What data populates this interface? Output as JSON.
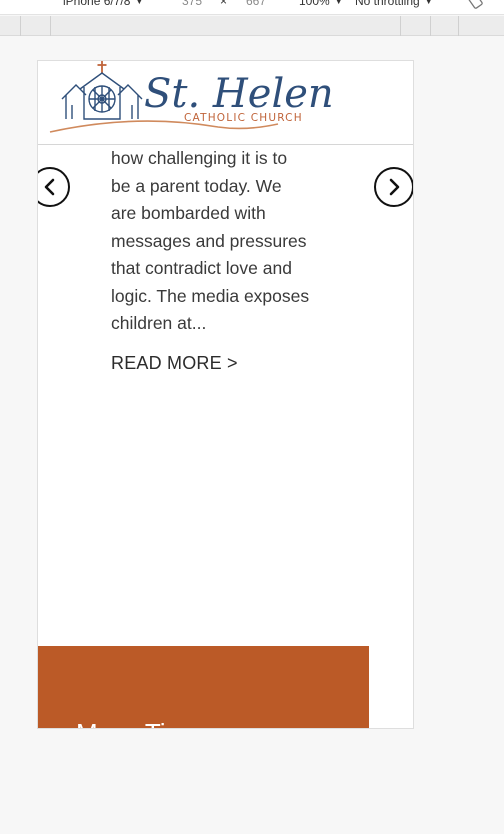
{
  "devtools": {
    "device_label": "iPhone 6/7/8",
    "width_value": "375",
    "times_symbol": "×",
    "height_value": "667",
    "zoom_label": "100%",
    "throttle_label": "No throttling",
    "caret_icon": "▼"
  },
  "site": {
    "logo": {
      "title": "St. Helen",
      "subtitle": "CATHOLIC CHURCH",
      "title_color": "#2f4f7a",
      "subtitle_color": "#c0643a",
      "cross_color": "#c0643a"
    },
    "slider": {
      "excerpt_lines": [
        "how challenging it is to",
        "be a parent today. We",
        "are bombarded with",
        "messages and pressures",
        "that contradict love and",
        "logic. The media exposes",
        "children at..."
      ],
      "read_more": "READ MORE >"
    },
    "section": {
      "title": "Mass Times",
      "bg_color": "#bb5a27"
    }
  }
}
